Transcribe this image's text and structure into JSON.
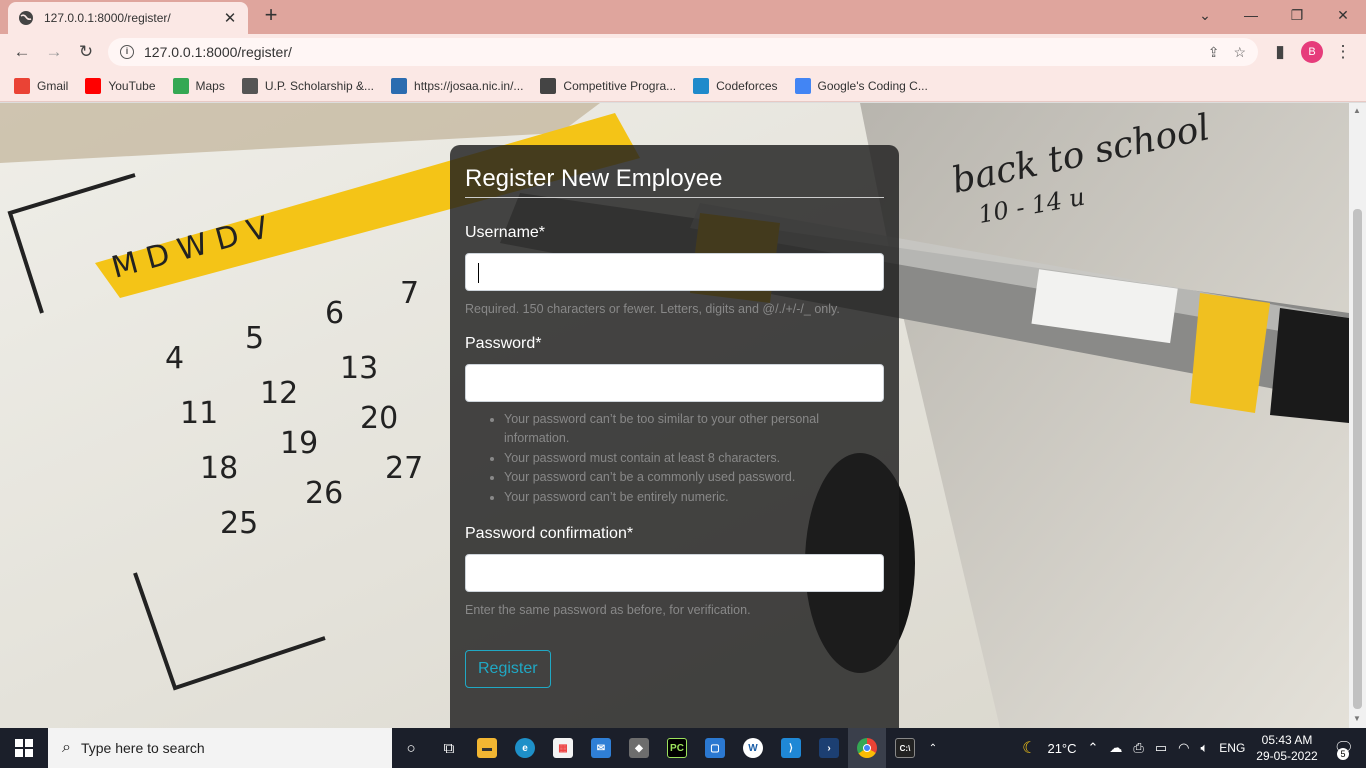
{
  "browser": {
    "tab_title": "127.0.0.1:8000/register/",
    "url": "127.0.0.1:8000/register/",
    "profile_initial": "B",
    "bookmarks": [
      {
        "label": "Gmail",
        "icon": "gmail-icon",
        "color": "#ea4335"
      },
      {
        "label": "YouTube",
        "icon": "youtube-icon",
        "color": "#ff0000"
      },
      {
        "label": "Maps",
        "icon": "maps-icon",
        "color": "#34a853"
      },
      {
        "label": "U.P. Scholarship &...",
        "icon": "globe-icon",
        "color": "#555555"
      },
      {
        "label": "https://josaa.nic.in/...",
        "icon": "nic-icon",
        "color": "#2b6cb0"
      },
      {
        "label": "Competitive Progra...",
        "icon": "cc-icon",
        "color": "#444444"
      },
      {
        "label": "Codeforces",
        "icon": "codeforces-icon",
        "color": "#1f8acb"
      },
      {
        "label": "Google's Coding C...",
        "icon": "google-icon",
        "color": "#4285f4"
      }
    ]
  },
  "form": {
    "title": "Register New Employee",
    "username_label": "Username*",
    "username_help": "Required. 150 characters or fewer. Letters, digits and @/./+/-/_ only.",
    "password_label": "Password*",
    "password_rules": [
      "Your password can’t be too similar to your other personal information.",
      "Your password must contain at least 8 characters.",
      "Your password can’t be a commonly used password.",
      "Your password can’t be entirely numeric."
    ],
    "confirm_label": "Password confirmation*",
    "confirm_help": "Enter the same password as before, for verification.",
    "submit_label": "Register"
  },
  "taskbar": {
    "search_placeholder": "Type here to search",
    "temperature": "21°C",
    "language": "ENG",
    "time": "05:43 AM",
    "date": "29-05-2022",
    "notification_count": "5"
  },
  "colors": {
    "accent": "#20a8c4",
    "tabbar": "#dfa59d",
    "toolbar": "#fbe8e5"
  }
}
